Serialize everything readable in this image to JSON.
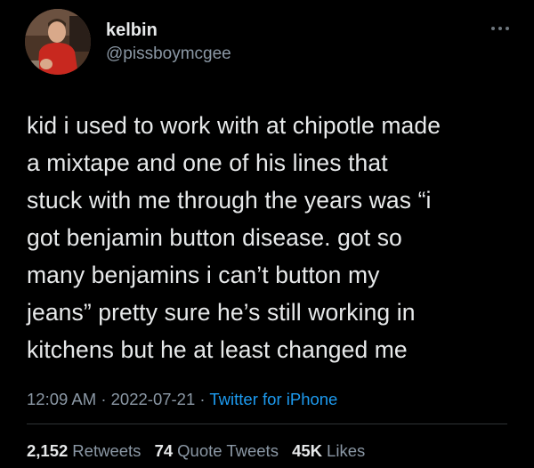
{
  "author": {
    "display_name": "kelbin",
    "handle": "@pissboymcgee",
    "avatar_icon": "profile-photo"
  },
  "menu_icon": "more-horizontal-icon",
  "tweet_text": "kid i used to work with at chipotle made\na mixtape and one of his lines that\nstuck with me through the years was “i\ngot benjamin button disease. got so\nmany benjamins i can’t button my\njeans” pretty sure he’s still working in\nkitchens but he at least changed me",
  "meta": {
    "time": "12:09 AM",
    "separator": "·",
    "date": "2022-07-21",
    "source": "Twitter for iPhone"
  },
  "stats": {
    "retweets_count": "2,152",
    "retweets_label": "Retweets",
    "quotes_count": "74",
    "quotes_label": "Quote Tweets",
    "likes_count": "45K",
    "likes_label": "Likes"
  },
  "colors": {
    "background": "#000000",
    "text": "#e7e9ea",
    "secondary": "#8b98a5",
    "link": "#1d9bf0"
  }
}
